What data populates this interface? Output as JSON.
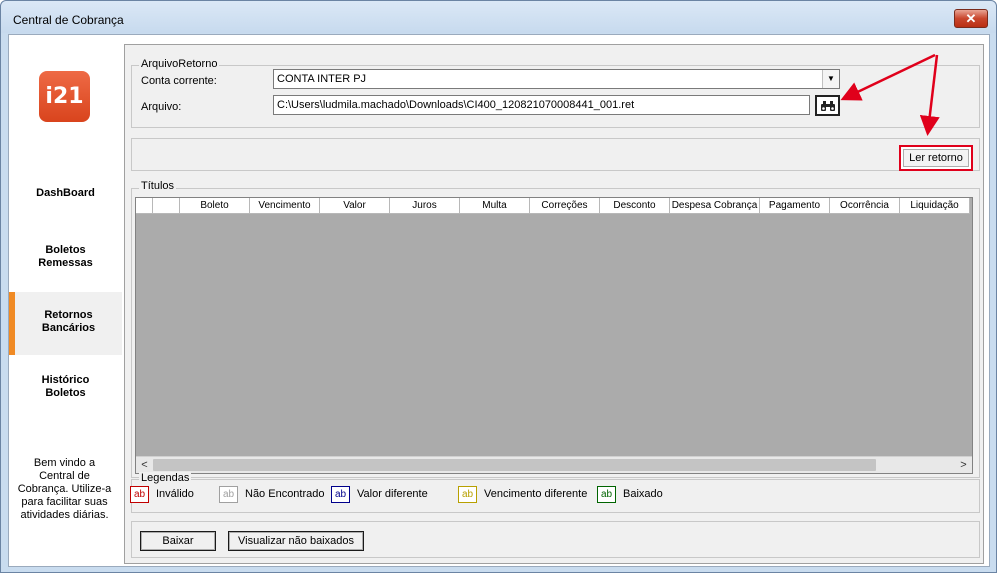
{
  "window": {
    "title": "Central de Cobrança",
    "close_glyph": "✕"
  },
  "sidebar": {
    "logo_text": "i21",
    "items": [
      {
        "label_line1": "DashBoard",
        "label_line2": ""
      },
      {
        "label_line1": "Boletos",
        "label_line2": "Remessas"
      },
      {
        "label_line1": "Retornos",
        "label_line2": "Bancários"
      },
      {
        "label_line1": "Histórico",
        "label_line2": "Boletos"
      }
    ],
    "active_index": 2,
    "welcome": [
      "Bem vindo a",
      "Central de",
      "Cobrança. Utilize-a",
      "para facilitar suas",
      "atividades diárias."
    ]
  },
  "arquivo_retorno": {
    "legend": "ArquivoRetorno",
    "conta_label": "Conta corrente:",
    "conta_value": "CONTA INTER PJ",
    "arquivo_label": "Arquivo:",
    "arquivo_value": "C:\\Users\\ludmila.machado\\Downloads\\CI400_120821070008441_001.ret",
    "browse_icon": "binoculars-icon"
  },
  "ler_retorno_label": "Ler retorno",
  "titulos": {
    "legend": "Títulos",
    "columns": [
      "Boleto",
      "Vencimento",
      "Valor",
      "Juros",
      "Multa",
      "Correções",
      "Desconto",
      "Despesa Cobrança",
      "Pagamento",
      "Ocorrência",
      "Liquidação"
    ],
    "scroll_left": "<",
    "scroll_right": ">"
  },
  "legendas": {
    "legend": "Legendas",
    "items": [
      {
        "chip": "ab",
        "label": "Inválido",
        "color": "#c00000"
      },
      {
        "chip": "ab",
        "label": "Não Encontrado",
        "color": "#a0a0a0"
      },
      {
        "chip": "ab",
        "label": "Valor diferente",
        "color": "#00008b"
      },
      {
        "chip": "ab",
        "label": "Vencimento diferente",
        "color": "#b8a000"
      },
      {
        "chip": "ab",
        "label": "Baixado",
        "color": "#006400"
      }
    ]
  },
  "footer": {
    "baixar_label": "Baixar",
    "visualizar_label": "Visualizar não baixados"
  },
  "colors": {
    "accent_orange": "#f08a24",
    "highlight_red": "#e0001b",
    "titlebar": "#c7daee"
  }
}
